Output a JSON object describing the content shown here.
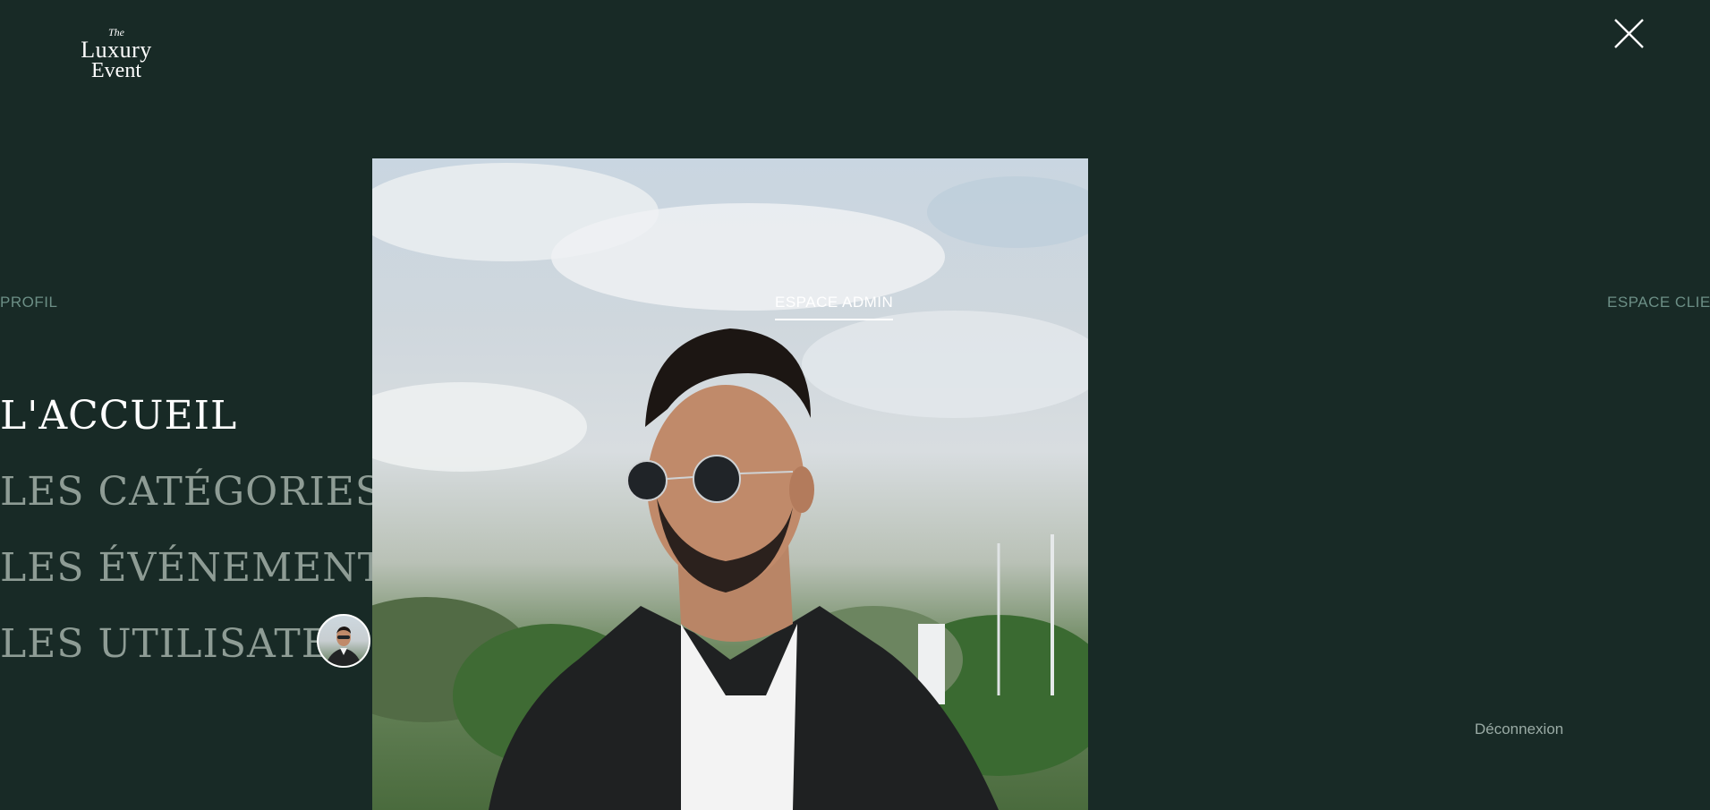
{
  "logo": {
    "line1": "The",
    "line2": "Luxury",
    "line3": "Event"
  },
  "close": {
    "icon": "close-icon"
  },
  "tabs": [
    {
      "label": "PROFIL",
      "active": false
    },
    {
      "label": "ESPACE ADMIN",
      "active": true
    },
    {
      "label": "ESPACE CLIENT",
      "active": false
    }
  ],
  "nav": [
    {
      "label": "L'ACCUEIL",
      "active": true
    },
    {
      "label": "LES CATÉGORIES",
      "active": false
    },
    {
      "label": "LES ÉVÉNEMENTS",
      "active": false
    },
    {
      "label": "LES UTILISATEURS",
      "active": false
    }
  ],
  "logout": "Déconnexion",
  "colors": {
    "background": "#182a26",
    "active_text": "#ffffff",
    "inactive_tab": "#6c8f86",
    "inactive_nav": "#8e9c95"
  }
}
